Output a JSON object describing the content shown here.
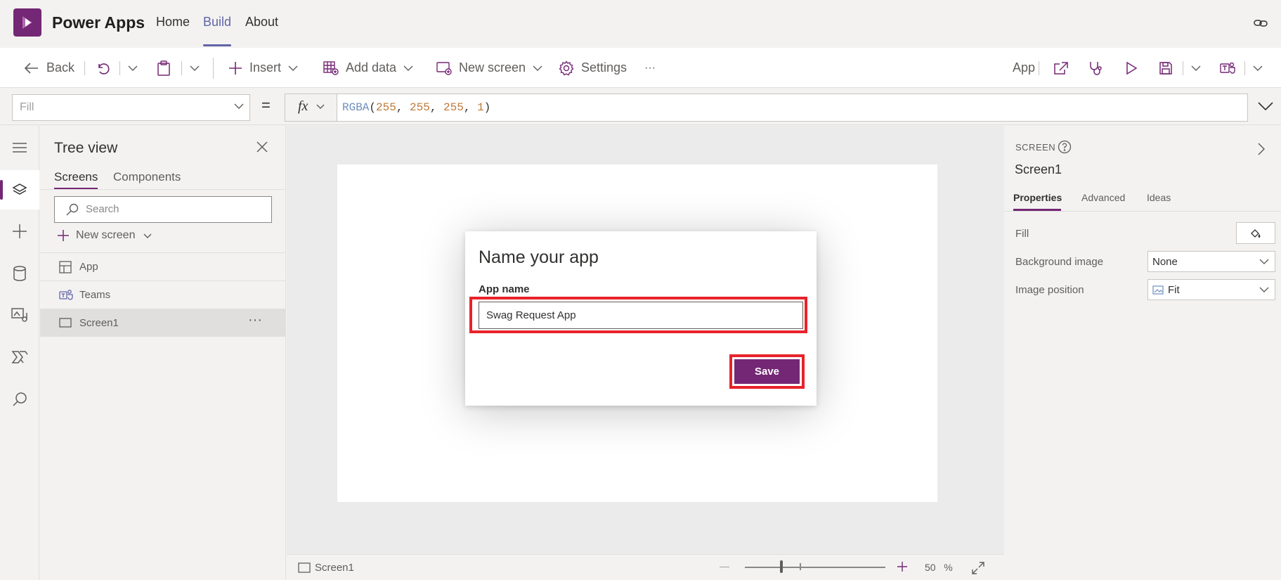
{
  "header": {
    "app_title": "Power Apps",
    "nav": [
      "Home",
      "Build",
      "About"
    ],
    "active_nav": "Build"
  },
  "commandbar": {
    "back": "Back",
    "insert": "Insert",
    "add_data": "Add data",
    "new_screen": "New screen",
    "settings": "Settings",
    "more": "···",
    "app_label": "App"
  },
  "formula_bar": {
    "property": "Fill",
    "equals": "=",
    "fx": "fx",
    "formula": {
      "fn": "RGBA",
      "open": "(",
      "args": [
        "255",
        "255",
        "255",
        "1"
      ],
      "sep": ", ",
      "close": ")"
    }
  },
  "tree_view": {
    "title": "Tree view",
    "tabs": [
      "Screens",
      "Components"
    ],
    "active_tab": "Screens",
    "search_placeholder": "Search",
    "new_screen": "New screen",
    "items": [
      {
        "label": "App",
        "icon": "app-grid-icon"
      },
      {
        "label": "Teams",
        "icon": "teams-icon"
      },
      {
        "label": "Screen1",
        "icon": "screen-icon",
        "selected": true
      }
    ],
    "more": "···"
  },
  "dialog": {
    "title": "Name your app",
    "field_label": "App name",
    "field_value": "Swag Request App",
    "save_label": "Save"
  },
  "status_bar": {
    "screen": "Screen1",
    "zoom": "50",
    "zoom_unit": "%"
  },
  "properties_pane": {
    "type": "SCREEN",
    "name": "Screen1",
    "tabs": [
      "Properties",
      "Advanced",
      "Ideas"
    ],
    "active_tab": "Properties",
    "rows": [
      {
        "label": "Fill"
      },
      {
        "label": "Background image",
        "value": "None"
      },
      {
        "label": "Image position",
        "value": "Fit"
      }
    ]
  },
  "colors": {
    "brand": "#742774",
    "nav_active": "#6264a7",
    "highlight": "#e8232a",
    "canvas": "#ebebeb"
  }
}
